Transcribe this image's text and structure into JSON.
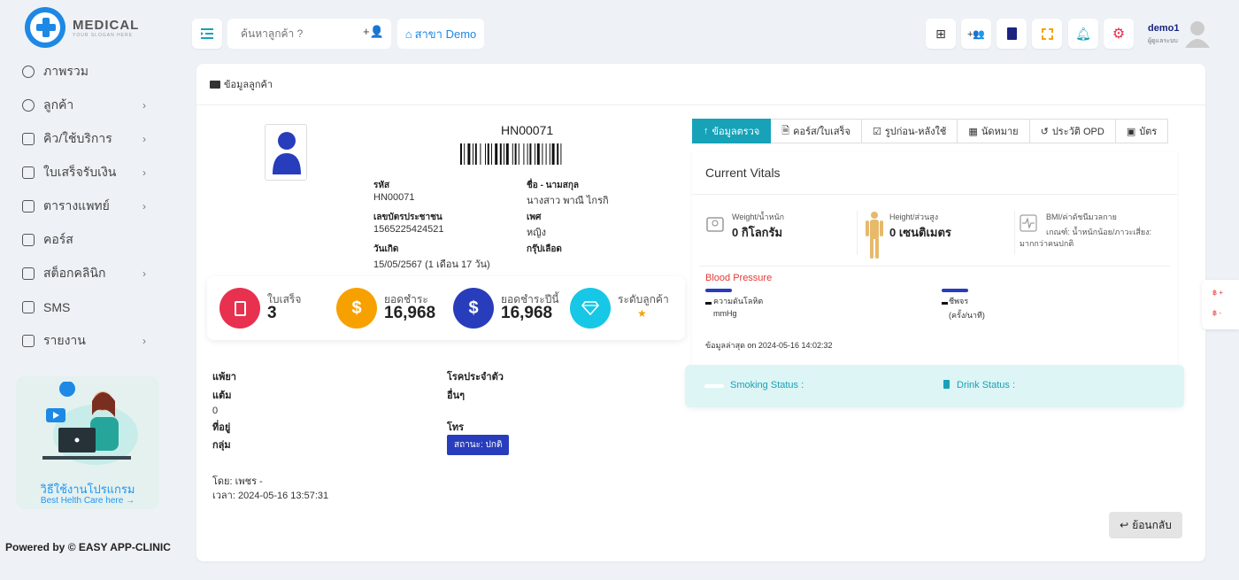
{
  "brand": {
    "title": "MEDICAL",
    "subtitle": "YOUR SLOGAN HERE"
  },
  "sidebar": {
    "items": [
      {
        "label": "ภาพรวม",
        "icon": "pie-chart-icon",
        "chevron": ""
      },
      {
        "label": "ลูกค้า",
        "icon": "users-icon",
        "chevron": "›"
      },
      {
        "label": "คิว/ใช้บริการ",
        "icon": "monitor-icon",
        "chevron": "›"
      },
      {
        "label": "ใบเสร็จรับเงิน",
        "icon": "file-icon",
        "chevron": "›"
      },
      {
        "label": "ตารางแพทย์",
        "icon": "calendar-icon",
        "chevron": "›"
      },
      {
        "label": "คอร์ส",
        "icon": "book-icon",
        "chevron": ""
      },
      {
        "label": "สต็อกคลินิก",
        "icon": "server-icon",
        "chevron": "›"
      },
      {
        "label": "SMS",
        "icon": "mail-icon",
        "chevron": ""
      },
      {
        "label": "รายงาน",
        "icon": "layers-icon",
        "chevron": "›"
      }
    ],
    "promo_title": "วิธีใช้งานโปรแกรม",
    "promo_link": "Best Helth Care here →",
    "powered": "Powered by © EASY APP-CLINIC"
  },
  "topbar": {
    "search_placeholder": "ค้นหาลูกค้า ?",
    "branch": "สาขา Demo",
    "user_name": "demo1",
    "user_role": "ผู้ดูแลระบบ"
  },
  "card": {
    "header": "ข้อมูลลูกค้า"
  },
  "patient": {
    "hn": "HN00071",
    "code_label": "รหัส",
    "code": "HN00071",
    "name_label": "ชื่อ - นามสกุล",
    "name": "นางสาว พาณี ไกรกิ",
    "id_label": "เลขบัตรประชาชน",
    "id": "1565225424521",
    "gender_label": "เพศ",
    "gender": "หญิง",
    "dob_label": "วันเกิด",
    "dob": "15/05/2567 (1 เดือน 17 วัน)",
    "blood_label": "กรุ๊ปเลือด",
    "blood": ""
  },
  "stats": [
    {
      "label": "ใบเสร็จ",
      "value": "3",
      "color": "#e8304f",
      "icon": "receipt-icon"
    },
    {
      "label": "ยอดชำระ",
      "value": "16,968",
      "color": "#f7a100",
      "icon": "dollar-icon"
    },
    {
      "label": "ยอดชำระปีนี้",
      "value": "16,968",
      "color": "#283dbb",
      "icon": "dollar-icon"
    },
    {
      "label": "ระดับลูกค้า",
      "value": "★",
      "color": "#17c7e6",
      "icon": "diamond-icon"
    }
  ],
  "details": {
    "allergy_label": "แพ้ยา",
    "chronic_label": "โรคประจำตัว",
    "points_label": "แต้ม",
    "points": "0",
    "other_label": "อื่นๆ",
    "address_label": "ที่อยู่",
    "phone_label": "โทร",
    "group_label": "กลุ่ม",
    "status_badge": "สถานะ: ปกติ",
    "by": "โดย: เพชร -",
    "time": "เวลา: 2024-05-16 13:57:31"
  },
  "tabs": [
    {
      "label": "ข้อมูลตรวจ",
      "icon": "arrow-up-icon",
      "active": true
    },
    {
      "label": "คอร์ส/ใบเสร็จ",
      "icon": "file-icon",
      "active": false
    },
    {
      "label": "รูปก่อน-หลังใช้",
      "icon": "check-square-icon",
      "active": false
    },
    {
      "label": "นัดหมาย",
      "icon": "calendar-icon",
      "active": false
    },
    {
      "label": "ประวัติ OPD",
      "icon": "history-icon",
      "active": false
    },
    {
      "label": "บัตร",
      "icon": "id-card-icon",
      "active": false
    }
  ],
  "vitals": {
    "title": "Current Vitals",
    "weight_label": "Weight/น้ำหนัก",
    "weight": "0 กิโลกรัม",
    "height_label": "Height/ส่วนสูง",
    "height": "0 เซนติเมตร",
    "bmi_label": "BMI/ค่าดัชนีมวลกาย",
    "bmi_text1": "เกณฑ์: น้ำหนักน้อย/ภาวะเสี่ยง:",
    "bmi_text2": "มากกว่าคนปกติ",
    "bp_title": "Blood Pressure",
    "bp_label": "ความดันโลหิต",
    "bp_unit": "mmHg",
    "pulse_label": "ชีพจร",
    "pulse_unit": "(ครั้ง/นาที)",
    "updated": "ข้อมูลล่าสุด on 2024-05-16 14:02:32",
    "smoking": "Smoking Status :",
    "drink": "Drink Status :"
  },
  "back_label": "ย้อนกลับ",
  "floater": {
    "plus": "฿ +",
    "minus": "฿ -"
  }
}
